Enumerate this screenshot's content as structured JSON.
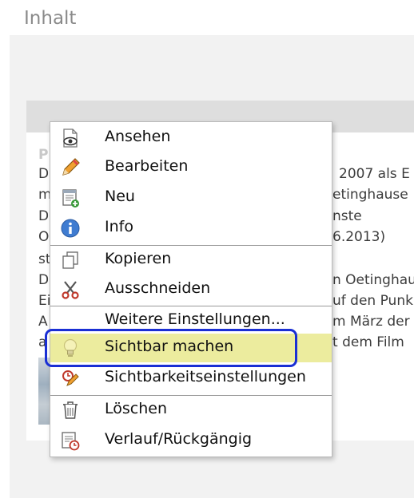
{
  "header": {
    "title": "Inhalt"
  },
  "background": {
    "lines": [
      "P",
      "D",
      "m",
      "D",
      "O",
      "st",
      "D",
      "Ei",
      "A",
      "a",
      "2007 als E",
      "etinghause",
      "nste",
      "6.2013)",
      "n Oetinghau",
      "uf den Punk",
      "m März der",
      "t dem Film"
    ]
  },
  "menu": {
    "items": [
      {
        "label": "Ansehen",
        "icon": "view-icon"
      },
      {
        "label": "Bearbeiten",
        "icon": "pencil-icon"
      },
      {
        "label": "Neu",
        "icon": "new-page-icon"
      },
      {
        "label": "Info",
        "icon": "info-icon"
      },
      {
        "label": "Kopieren",
        "icon": "copy-icon"
      },
      {
        "label": "Ausschneiden",
        "icon": "scissors-icon"
      },
      {
        "label": "Weitere Einstellungen...",
        "icon": ""
      },
      {
        "label": "Sichtbar machen",
        "icon": "lightbulb-icon"
      },
      {
        "label": "Sichtbarkeitseinstellungen",
        "icon": "visibility-settings-icon"
      },
      {
        "label": "Löschen",
        "icon": "trash-icon"
      },
      {
        "label": "Verlauf/Rückgängig",
        "icon": "history-icon"
      }
    ]
  },
  "colors": {
    "highlight": "#ecec9e",
    "focus_ring": "#1a2fd4"
  }
}
